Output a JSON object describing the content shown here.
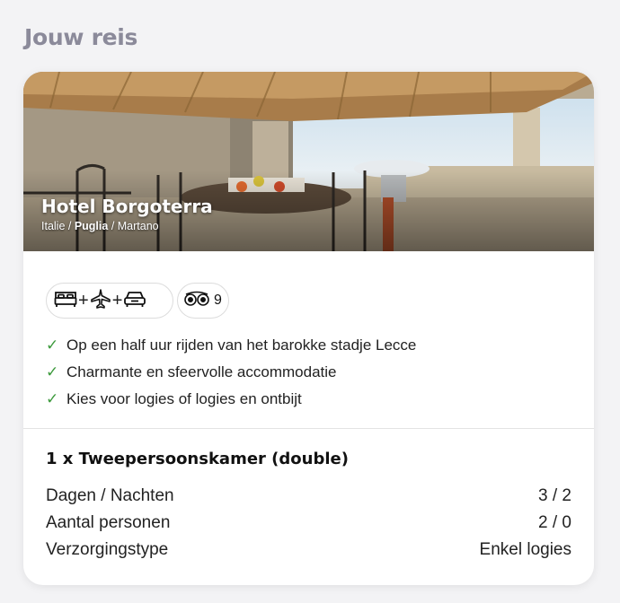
{
  "page": {
    "heading": "Jouw reis"
  },
  "hotel": {
    "name": "Hotel Borgoterra",
    "location": {
      "country": "Italie",
      "region": "Puglia",
      "city": "Martano",
      "separator": " / "
    }
  },
  "badges": {
    "transport_icons": [
      "bed-icon",
      "plane-icon",
      "car-icon"
    ],
    "plus": "+",
    "rating_icon": "tripadvisor-icon",
    "rating_value": "9"
  },
  "features": [
    {
      "icon": "check-icon",
      "text": "Op een half uur rijden van het barokke stadje Lecce"
    },
    {
      "icon": "check-icon",
      "text": "Charmante en sfeervolle accommodatie"
    },
    {
      "icon": "check-icon",
      "text": "Kies voor logies of logies en ontbijt"
    }
  ],
  "room": {
    "title": "1 x Tweepersoonskamer (double)",
    "details": [
      {
        "label": "Dagen / Nachten",
        "value": "3 / 2"
      },
      {
        "label": "Aantal personen",
        "value": "2 / 0"
      },
      {
        "label": "Verzorgingstype",
        "value": "Enkel logies"
      }
    ]
  },
  "colors": {
    "heading": "#8b8a9a",
    "check": "#3d9a3d",
    "background": "#f3f3f5",
    "card": "#ffffff"
  }
}
